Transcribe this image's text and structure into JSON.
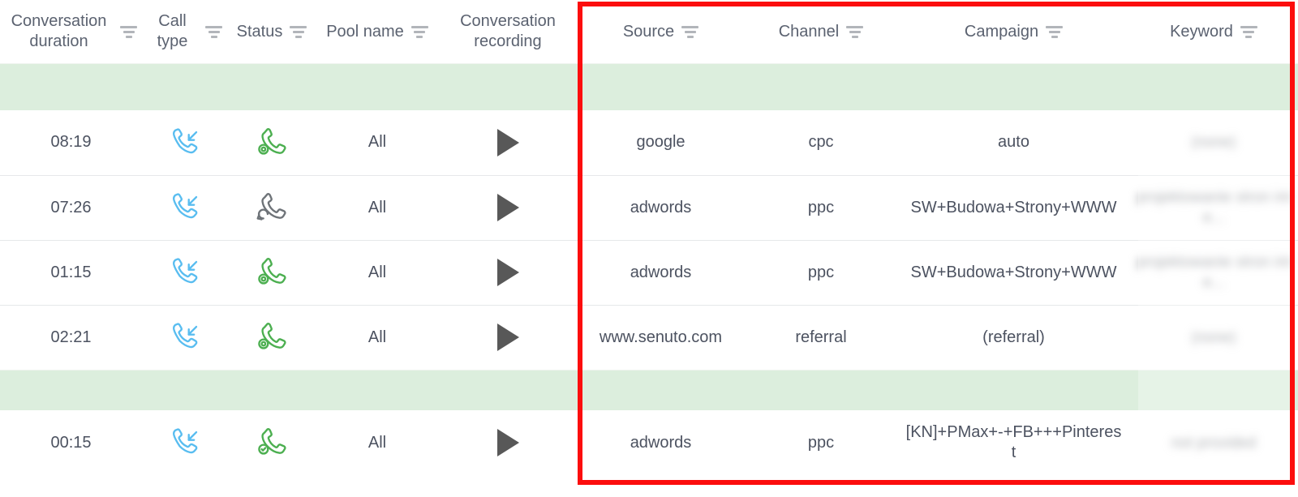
{
  "table": {
    "columns": [
      {
        "key": "duration",
        "label": "Conversation duration",
        "filter": true,
        "name": "column-conversation-duration"
      },
      {
        "key": "calltype",
        "label": "Call type",
        "filter": true,
        "name": "column-call-type"
      },
      {
        "key": "status",
        "label": "Status",
        "filter": true,
        "name": "column-status"
      },
      {
        "key": "pool",
        "label": "Pool name",
        "filter": true,
        "name": "column-pool-name"
      },
      {
        "key": "recording",
        "label": "Conversation recording",
        "filter": false,
        "name": "column-conversation-recording"
      },
      {
        "key": "source",
        "label": "Source",
        "filter": true,
        "name": "column-source"
      },
      {
        "key": "channel",
        "label": "Channel",
        "filter": true,
        "name": "column-channel"
      },
      {
        "key": "campaign",
        "label": "Campaign",
        "filter": true,
        "name": "column-campaign"
      },
      {
        "key": "keyword",
        "label": "Keyword",
        "filter": true,
        "name": "column-keyword"
      }
    ],
    "rows": [
      {
        "duration": "08:19",
        "call_type_icon": "incoming-call-icon",
        "status_icon": "call-missed-target-icon",
        "status_color": "#4caf50",
        "pool": "All",
        "recording_icon": "play-icon",
        "source": "google",
        "channel": "cpc",
        "campaign": "auto",
        "keyword": "(none)"
      },
      {
        "duration": "07:26",
        "call_type_icon": "incoming-call-icon",
        "status_icon": "call-returned-icon",
        "status_color": "#6e7378",
        "pool": "All",
        "recording_icon": "play-icon",
        "source": "adwords",
        "channel": "ppc",
        "campaign": "SW+Budowa+Strony+WWW",
        "keyword": "projektowanie stron inte..."
      },
      {
        "duration": "01:15",
        "call_type_icon": "incoming-call-icon",
        "status_icon": "call-missed-target-icon",
        "status_color": "#4caf50",
        "pool": "All",
        "recording_icon": "play-icon",
        "source": "adwords",
        "channel": "ppc",
        "campaign": "SW+Budowa+Strony+WWW",
        "keyword": "projektowanie stron inte..."
      },
      {
        "duration": "02:21",
        "call_type_icon": "incoming-call-icon",
        "status_icon": "call-missed-target-icon",
        "status_color": "#4caf50",
        "pool": "All",
        "recording_icon": "play-icon",
        "source": "www.senuto.com",
        "channel": "referral",
        "campaign": "(referral)",
        "keyword": "(none)"
      },
      {
        "duration": "00:15",
        "call_type_icon": "incoming-call-icon",
        "status_icon": "call-answered-check-icon",
        "status_color": "#4caf50",
        "pool": "All",
        "recording_icon": "play-icon",
        "source": "adwords",
        "channel": "ppc",
        "campaign": "[KN]+PMax+-+FB+++Pinterest",
        "keyword": "not provided"
      }
    ]
  },
  "colors": {
    "group_band": "#dceedd",
    "highlight_box": "#fc0d0d",
    "header_text": "#5b6270",
    "cell_text": "#4c5260",
    "incoming_icon": "#59bdf0",
    "answered_icon": "#4caf50",
    "missed_icon": "#6e7378",
    "play_icon": "#585858",
    "filter_icon": "#b2b5ba"
  },
  "annotations": {
    "highlight_box_name": "red-highlight-box",
    "highlight_box_covers": "Source, Channel, Campaign, Keyword columns"
  }
}
